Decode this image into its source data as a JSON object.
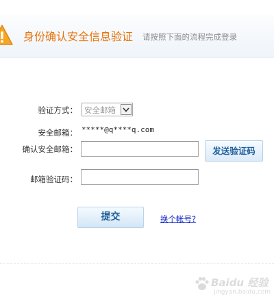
{
  "header": {
    "title": "身份确认安全信息验证",
    "subtitle": "请按照下面的流程完成登录"
  },
  "form": {
    "method_label": "验证方式：",
    "method_selected": "安全邮箱",
    "email_label": "安全邮箱：",
    "email_value": "*****@q****q.com",
    "confirm_email_label": "确认安全邮箱：",
    "confirm_email_value": "",
    "send_code_button": "发送验证码",
    "code_label": "邮箱验证码：",
    "code_value": "",
    "submit_button": "提交",
    "switch_account_link": "换个帐号?"
  },
  "watermark": {
    "text": "Baidu 经验",
    "subtext": "jingyan.baidu.com"
  },
  "colors": {
    "title": "#e8730c",
    "warning": "#f5a623",
    "button_text": "#1f5f9e",
    "link": "#0f22c8"
  }
}
